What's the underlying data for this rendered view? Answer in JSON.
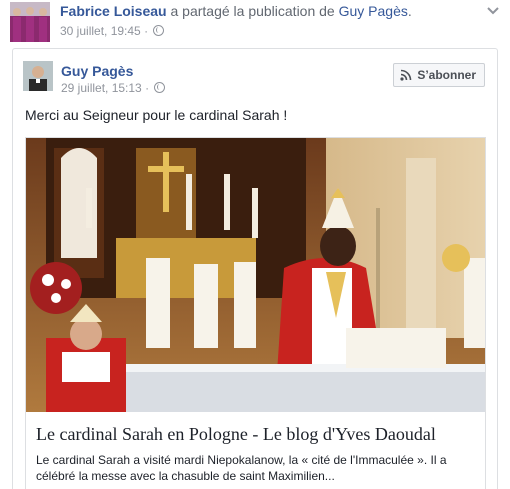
{
  "share": {
    "sharer_name": "Fabrice Loiseau",
    "action_text": "a partagé la publication de",
    "original_author": "Guy Pagès",
    "end_punct": ".",
    "timestamp": "30 juillet, 19:45",
    "separator": "·",
    "privacy_icon": "globe-icon",
    "menu_icon": "chevron-down-icon"
  },
  "post": {
    "author": "Guy Pagès",
    "timestamp": "29 juillet, 15:13",
    "separator": "·",
    "privacy_icon": "globe-icon",
    "subscribe_label": "S’abonner",
    "subscribe_icon": "rss-icon",
    "text": "Merci au Seigneur pour le cardinal Sarah !"
  },
  "link_preview": {
    "title": "Le cardinal Sarah en Pologne - Le blog d'Yves Daoudal",
    "description": "Le cardinal Sarah a visité mardi Niepokalanow, la « cité de l'Immaculée ». Il a célébré la messe avec la chasuble de saint Maximilien..."
  },
  "colors": {
    "link_blue": "#365899",
    "meta_gray": "#90949c",
    "border": "#dddfe2",
    "vestment_red": "#c8231f"
  }
}
